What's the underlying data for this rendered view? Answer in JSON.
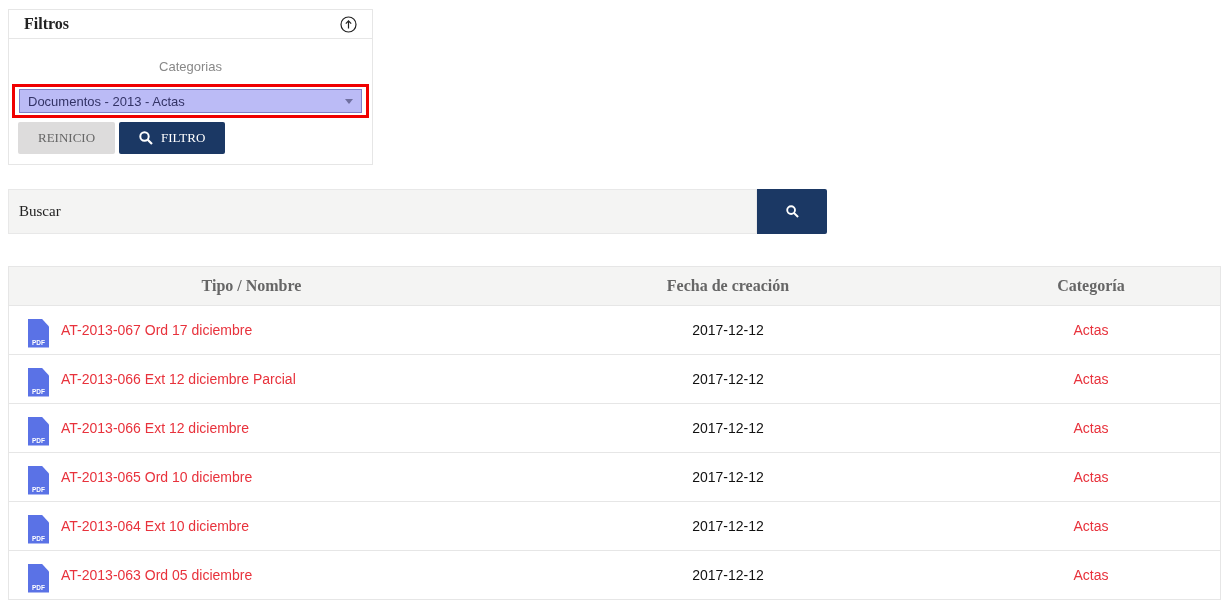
{
  "filters": {
    "title": "Filtros",
    "category_label": "Categorias",
    "category_select": {
      "value": "Documentos - 2013 - Actas",
      "highlighted": true
    },
    "buttons": [
      {
        "kind": "reset",
        "label": "REINICIO"
      },
      {
        "kind": "filter",
        "label": "FILTRO"
      }
    ]
  },
  "search": {
    "placeholder": "Buscar"
  },
  "table": {
    "columns": [
      "Tipo / Nombre",
      "Fecha de creación",
      "Categoría"
    ],
    "rows": [
      {
        "file_type": "PDF",
        "name": "AT-2013-067 Ord 17 diciembre",
        "date": "2017-12-12",
        "category": "Actas"
      },
      {
        "file_type": "PDF",
        "name": "AT-2013-066 Ext 12 diciembre Parcial",
        "date": "2017-12-12",
        "category": "Actas"
      },
      {
        "file_type": "PDF",
        "name": "AT-2013-066 Ext 12 diciembre",
        "date": "2017-12-12",
        "category": "Actas"
      },
      {
        "file_type": "PDF",
        "name": "AT-2013-065 Ord 10 diciembre",
        "date": "2017-12-12",
        "category": "Actas"
      },
      {
        "file_type": "PDF",
        "name": "AT-2013-064 Ext 10 diciembre",
        "date": "2017-12-12",
        "category": "Actas"
      },
      {
        "file_type": "PDF",
        "name": "AT-2013-063 Ord 05 diciembre",
        "date": "2017-12-12",
        "category": "Actas"
      }
    ]
  }
}
